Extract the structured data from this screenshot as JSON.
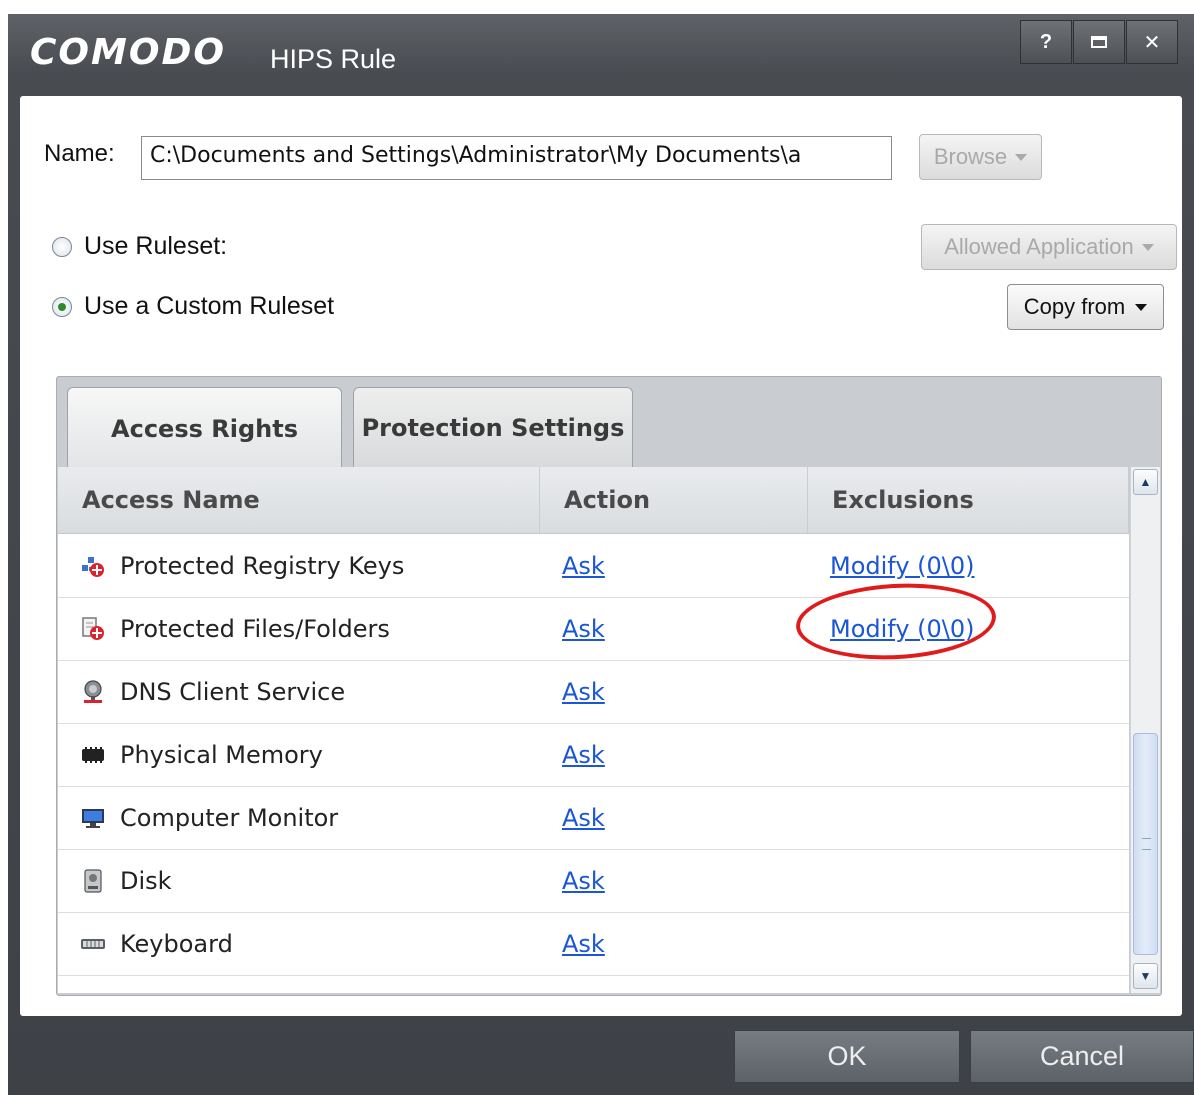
{
  "window": {
    "brand": "COMODO",
    "title": "HIPS Rule",
    "controls": {
      "help": "?",
      "maximize": "☐",
      "close": "✕"
    }
  },
  "name_row": {
    "label": "Name:",
    "value": "C:\\Documents and Settings\\Administrator\\My Documents\\a",
    "browse_label": "Browse"
  },
  "ruleset": {
    "use_ruleset_label": "Use Ruleset:",
    "use_custom_label": "Use a Custom Ruleset",
    "selected": "custom",
    "ruleset_dropdown_value": "Allowed Application",
    "copy_from_label": "Copy from"
  },
  "tabs": [
    {
      "label": "Access Rights",
      "active": true
    },
    {
      "label": "Protection Settings",
      "active": false
    }
  ],
  "table": {
    "columns": [
      "Access Name",
      "Action",
      "Exclusions"
    ],
    "rows": [
      {
        "icon": "registry-keys-icon",
        "name": "Protected Registry Keys",
        "action": "Ask",
        "exclusions": "Modify (0\\0)"
      },
      {
        "icon": "files-folders-icon",
        "name": "Protected Files/Folders",
        "action": "Ask",
        "exclusions": "Modify (0\\0)"
      },
      {
        "icon": "dns-client-icon",
        "name": "DNS Client Service",
        "action": "Ask",
        "exclusions": ""
      },
      {
        "icon": "memory-icon",
        "name": "Physical Memory",
        "action": "Ask",
        "exclusions": ""
      },
      {
        "icon": "monitor-icon",
        "name": "Computer Monitor",
        "action": "Ask",
        "exclusions": ""
      },
      {
        "icon": "disk-icon",
        "name": "Disk",
        "action": "Ask",
        "exclusions": ""
      },
      {
        "icon": "keyboard-icon",
        "name": "Keyboard",
        "action": "Ask",
        "exclusions": ""
      }
    ]
  },
  "footer": {
    "ok_label": "OK",
    "cancel_label": "Cancel"
  },
  "colors": {
    "link": "#1a56d6",
    "annotation": "#e01b1b",
    "titlebar": "#4a4e53"
  }
}
